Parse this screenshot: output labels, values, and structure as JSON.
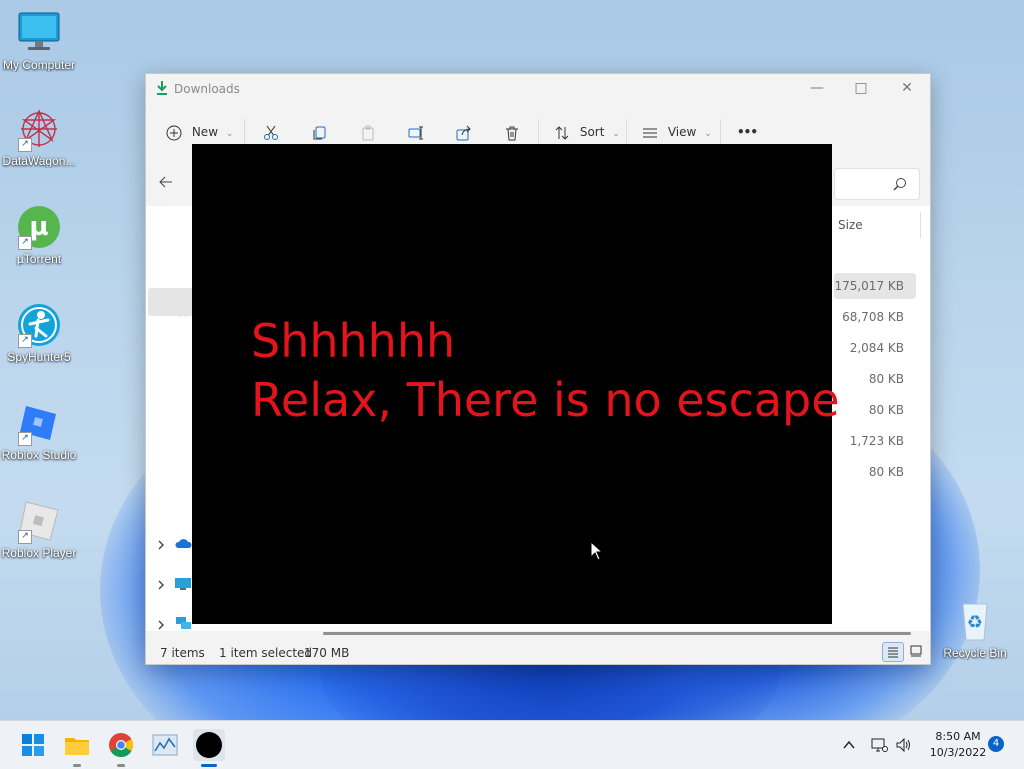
{
  "desktop": {
    "icons": [
      {
        "label": "My Computer"
      },
      {
        "label": "DataWagon..."
      },
      {
        "label": "µTorrent"
      },
      {
        "label": "SpyHunter5"
      },
      {
        "label": "Roblox Studio"
      },
      {
        "label": "Roblox Player"
      },
      {
        "label": "Recycle Bin"
      }
    ]
  },
  "explorer": {
    "title": "Downloads",
    "toolbar": {
      "new_label": "New",
      "sort_label": "Sort",
      "view_label": "View",
      "more_label": "•••"
    },
    "column_size_header": "Size",
    "sizes": [
      "175,017 KB",
      "68,708 KB",
      "2,084 KB",
      "80 KB",
      "80 KB",
      "1,723 KB",
      "80 KB"
    ],
    "status": {
      "items_count": "7 items",
      "selection": "1 item selected",
      "selection_size": "170 MB"
    }
  },
  "overlay": {
    "line1": "Shhhhhh",
    "line2": "Relax, There is no escape",
    "text_color": "#e3141b",
    "background": "#000000"
  },
  "taskbar": {
    "apps": [
      "start-icon",
      "file-explorer-icon",
      "chrome-icon",
      "task-manager-icon",
      "black-circle-app-icon"
    ],
    "time": "8:50 AM",
    "date": "10/3/2022",
    "notification_count": "4"
  },
  "colors": {
    "accent": "#0a64c8",
    "ransom_text": "#e3141b"
  }
}
